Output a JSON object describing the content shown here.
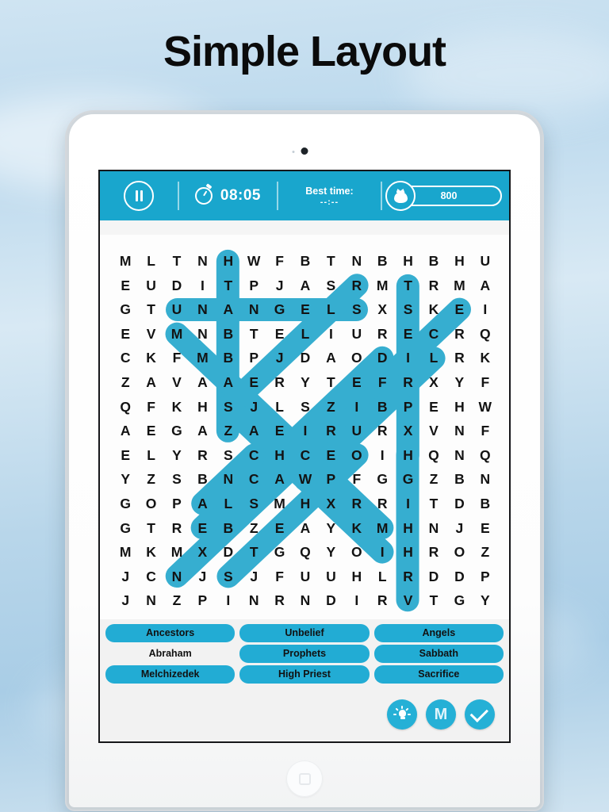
{
  "page_title": "Simple Layout",
  "colors": {
    "topbar_teal": "#19a6cd",
    "highlight_teal": "#36aed0",
    "pill_teal": "#22acd4",
    "tool_teal": "#25b0d6",
    "title_text": "#0b0b0b"
  },
  "topbar": {
    "pause_label": "Pause",
    "timer_icon": "stopwatch-icon",
    "timer_value": "08:05",
    "best_time_label": "Best time:",
    "best_time_value": "--:--",
    "coin_icon": "money-bag-icon",
    "score_value": "800"
  },
  "grid": {
    "rows": 15,
    "cols": 15,
    "letters": [
      [
        "M",
        "L",
        "T",
        "N",
        "H",
        "W",
        "F",
        "B",
        "T",
        "N",
        "B",
        "H",
        "B",
        "H",
        "U"
      ],
      [
        "E",
        "U",
        "D",
        "I",
        "T",
        "P",
        "J",
        "A",
        "S",
        "R",
        "M",
        "T",
        "R",
        "M",
        "A"
      ],
      [
        "G",
        "T",
        "U",
        "N",
        "A",
        "N",
        "G",
        "E",
        "L",
        "S",
        "X",
        "S",
        "K",
        "E",
        "I"
      ],
      [
        "E",
        "V",
        "M",
        "N",
        "B",
        "T",
        "E",
        "L",
        "I",
        "U",
        "R",
        "E",
        "C",
        "R",
        "Q"
      ],
      [
        "C",
        "K",
        "F",
        "M",
        "B",
        "P",
        "J",
        "D",
        "A",
        "O",
        "D",
        "I",
        "L",
        "R",
        "K"
      ],
      [
        "Z",
        "A",
        "V",
        "A",
        "A",
        "E",
        "R",
        "Y",
        "T",
        "E",
        "F",
        "R",
        "X",
        "Y",
        "F"
      ],
      [
        "Q",
        "F",
        "K",
        "H",
        "S",
        "J",
        "L",
        "S",
        "Z",
        "I",
        "B",
        "P",
        "E",
        "H",
        "W"
      ],
      [
        "A",
        "E",
        "G",
        "A",
        "Z",
        "A",
        "E",
        "I",
        "R",
        "U",
        "R",
        "X",
        "V",
        "N",
        "F"
      ],
      [
        "E",
        "L",
        "Y",
        "R",
        "S",
        "C",
        "H",
        "C",
        "E",
        "O",
        "I",
        "H",
        "Q",
        "N",
        "Q"
      ],
      [
        "Y",
        "Z",
        "S",
        "B",
        "N",
        "C",
        "A",
        "W",
        "P",
        "F",
        "G",
        "G",
        "Z",
        "B",
        "N"
      ],
      [
        "G",
        "O",
        "P",
        "A",
        "L",
        "S",
        "M",
        "H",
        "X",
        "R",
        "R",
        "I",
        "T",
        "D",
        "B"
      ],
      [
        "G",
        "T",
        "R",
        "E",
        "B",
        "Z",
        "E",
        "A",
        "Y",
        "K",
        "M",
        "H",
        "N",
        "J",
        "E"
      ],
      [
        "M",
        "K",
        "M",
        "X",
        "D",
        "T",
        "G",
        "Q",
        "Y",
        "O",
        "I",
        "H",
        "R",
        "O",
        "Z"
      ],
      [
        "J",
        "C",
        "N",
        "J",
        "S",
        "J",
        "F",
        "U",
        "U",
        "H",
        "L",
        "R",
        "D",
        "D",
        "P"
      ],
      [
        "J",
        "N",
        "Z",
        "P",
        "I",
        "N",
        "R",
        "N",
        "D",
        "I",
        "R",
        "V",
        "T",
        "G",
        "Y"
      ]
    ]
  },
  "words": {
    "rows": [
      [
        {
          "label": "Ancestors",
          "found": true
        },
        {
          "label": "Unbelief",
          "found": true
        },
        {
          "label": "Angels",
          "found": true
        }
      ],
      [
        {
          "label": "Abraham",
          "found": false
        },
        {
          "label": "Prophets",
          "found": true
        },
        {
          "label": "Sabbath",
          "found": true
        }
      ],
      [
        {
          "label": "Melchizedek",
          "found": true
        },
        {
          "label": "High Priest",
          "found": true
        },
        {
          "label": "Sacrifice",
          "found": true
        }
      ]
    ]
  },
  "toolbar": {
    "hint_label": "Hint",
    "hint_icon": "lightbulb-icon",
    "menu_label": "M",
    "menu_icon": "menu-m-icon",
    "confirm_label": "Confirm",
    "confirm_icon": "check-icon"
  },
  "device": {
    "camera_icon": "front-camera-icon",
    "home_button_label": "Home"
  }
}
